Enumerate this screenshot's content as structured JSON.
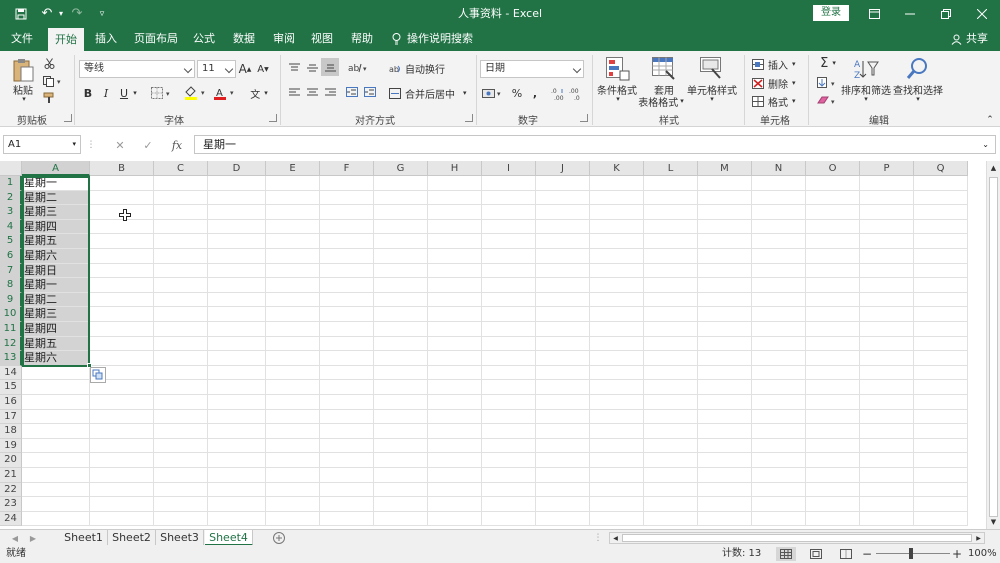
{
  "title": "人事资料  -  Excel",
  "account": {
    "login_label": "登录",
    "share_label": "共享"
  },
  "tabs": [
    "文件",
    "开始",
    "插入",
    "页面布局",
    "公式",
    "数据",
    "审阅",
    "视图",
    "帮助"
  ],
  "active_tab": "开始",
  "tell_me": "操作说明搜索",
  "ribbon": {
    "clipboard": {
      "label": "剪贴板",
      "paste": "粘贴"
    },
    "font": {
      "label": "字体",
      "name": "等线",
      "size": "11",
      "bold": "B",
      "italic": "I",
      "underline": "U",
      "grow": "A",
      "shrink": "A",
      "phonetic": "文"
    },
    "alignment": {
      "label": "对齐方式",
      "wrap": "自动换行",
      "merge": "合并后居中"
    },
    "number": {
      "label": "数字",
      "format": "日期",
      "percent": "%",
      "comma": ","
    },
    "styles": {
      "label": "样式",
      "conditional": "条件格式",
      "table_l1": "套用",
      "table_l2": "表格格式",
      "cell_styles": "单元格样式"
    },
    "cells": {
      "label": "单元格",
      "insert": "插入",
      "delete": "删除",
      "format": "格式"
    },
    "editing": {
      "label": "编辑",
      "sort": "排序和筛选",
      "find": "查找和选择"
    }
  },
  "formula_bar": {
    "name_box": "A1",
    "fx": "fx",
    "value": "星期一"
  },
  "columns": [
    "A",
    "B",
    "C",
    "D",
    "E",
    "F",
    "G",
    "H",
    "I",
    "J",
    "K",
    "L",
    "M",
    "N",
    "O",
    "P",
    "Q"
  ],
  "rows": [
    "1",
    "2",
    "3",
    "4",
    "5",
    "6",
    "7",
    "8",
    "9",
    "10",
    "11",
    "12",
    "13",
    "14",
    "15",
    "16",
    "17",
    "18",
    "19",
    "20",
    "21",
    "22",
    "23",
    "24"
  ],
  "column_a_values": [
    "星期一",
    "星期二",
    "星期三",
    "星期四",
    "星期五",
    "星期六",
    "星期日",
    "星期一",
    "星期二",
    "星期三",
    "星期四",
    "星期五",
    "星期六"
  ],
  "sheets": [
    "Sheet1",
    "Sheet2",
    "Sheet3",
    "Sheet4"
  ],
  "active_sheet": "Sheet4",
  "status": {
    "mode": "就绪",
    "count": "计数: 13",
    "zoom": "100%"
  },
  "colors": {
    "accent": "#217346",
    "selection": "#d3d3d3"
  }
}
